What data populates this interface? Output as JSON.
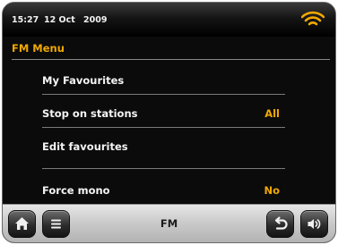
{
  "status": {
    "time": "15:27",
    "date": "12 Oct",
    "year": "2009",
    "wifi_icon": "wifi-icon"
  },
  "menu": {
    "title": "FM Menu",
    "items": [
      {
        "label": "My Favourites",
        "value": ""
      },
      {
        "label": "Stop on stations",
        "value": "All"
      },
      {
        "label": "Edit favourites",
        "value": ""
      },
      {
        "label": "Force mono",
        "value": "No"
      }
    ]
  },
  "bottom": {
    "mode_label": "FM"
  },
  "colors": {
    "accent": "#f0a800",
    "background": "#0b0b0b",
    "text": "#f5f5f5"
  }
}
